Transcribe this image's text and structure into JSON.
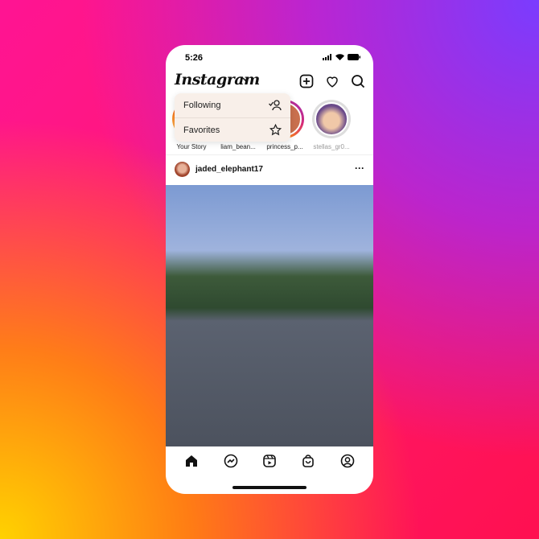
{
  "status": {
    "time": "5:26"
  },
  "header": {
    "logo": "Instagram",
    "icons": [
      "new-post-icon",
      "heart-icon",
      "search-icon"
    ]
  },
  "menu": {
    "items": [
      {
        "label": "Following",
        "icon": "following-icon"
      },
      {
        "label": "Favorites",
        "icon": "star-icon"
      }
    ]
  },
  "stories": [
    {
      "name": "Your Story"
    },
    {
      "name": "liam_bean..."
    },
    {
      "name": "princess_p..."
    },
    {
      "name": "stellas_gr0..."
    }
  ],
  "post": {
    "username": "jaded_elephant17",
    "more": "···"
  },
  "nav": {
    "items": [
      "home-icon",
      "messenger-icon",
      "reels-icon",
      "shop-icon",
      "profile-icon"
    ]
  }
}
